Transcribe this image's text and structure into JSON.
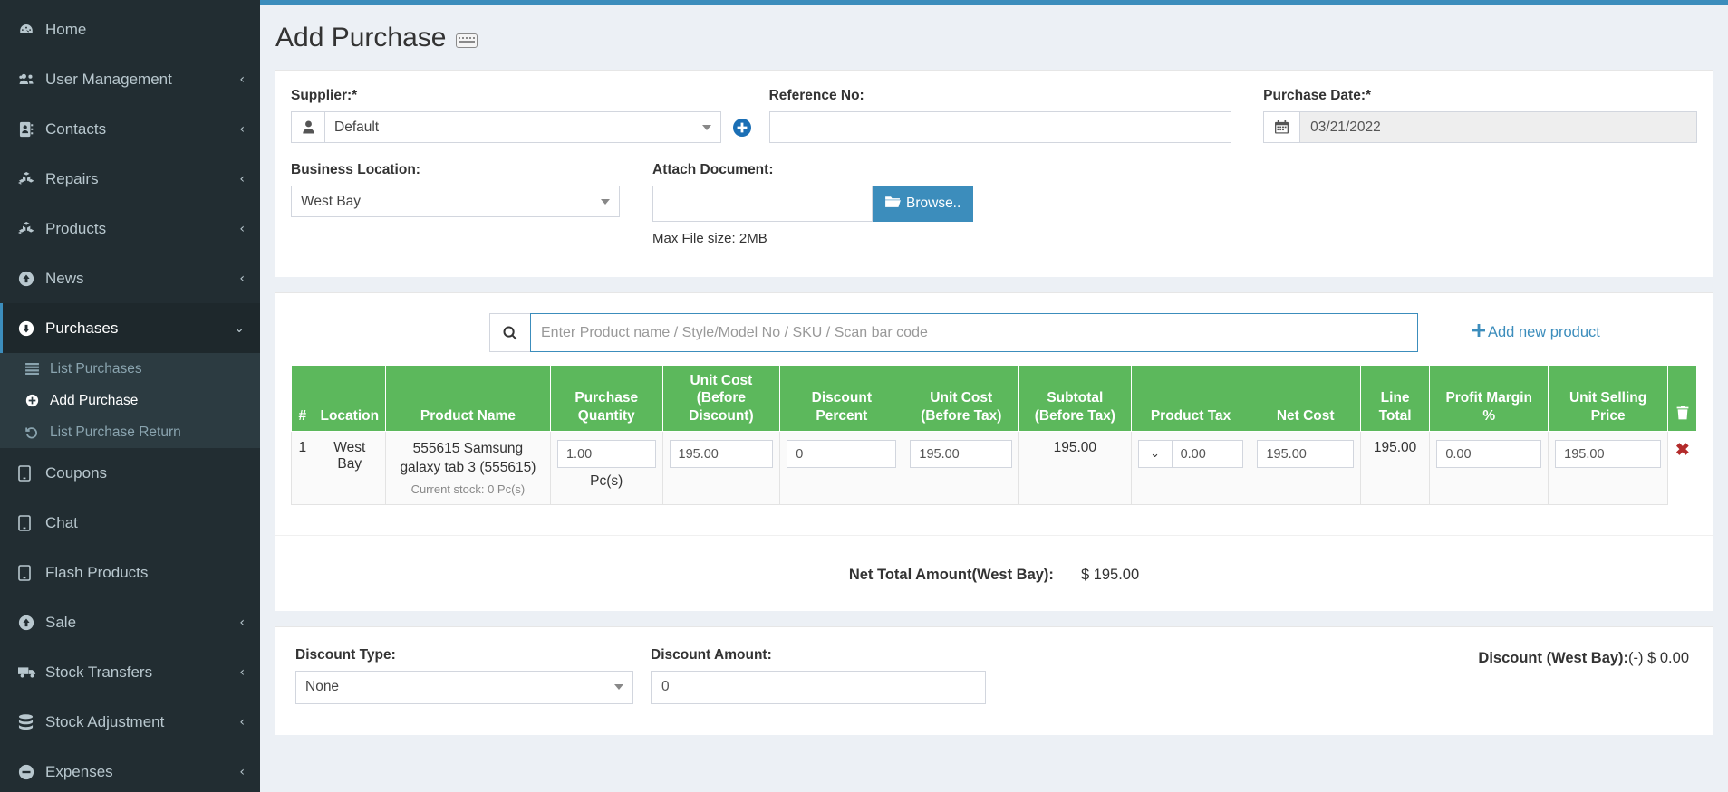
{
  "theme": {
    "accent": "#3c8dbc",
    "sidebar_bg": "#222d32",
    "table_header_green": "#5cb85c",
    "link_blue": "#3c8dbc",
    "delete_red": "#b32b2b"
  },
  "header": {
    "title": "Add Purchase",
    "keyboard_icon": "keyboard-icon"
  },
  "sidebar": {
    "items": [
      {
        "label": "Home",
        "icon": "dashboard-icon",
        "chevron": ""
      },
      {
        "label": "User Management",
        "icon": "users-icon",
        "chevron": "‹"
      },
      {
        "label": "Contacts",
        "icon": "address-book-icon",
        "chevron": "‹"
      },
      {
        "label": "Repairs",
        "icon": "cubes-icon",
        "chevron": "‹"
      },
      {
        "label": "Products",
        "icon": "cubes-icon",
        "chevron": "‹"
      },
      {
        "label": "News",
        "icon": "arrow-up-circle-icon",
        "chevron": "‹"
      },
      {
        "label": "Purchases",
        "icon": "arrow-down-circle-icon",
        "chevron": "⌄",
        "active": true
      }
    ],
    "subitems": [
      {
        "label": "List Purchases",
        "icon": "list-icon",
        "active": false
      },
      {
        "label": "Add Purchase",
        "icon": "plus-circle-icon",
        "active": true
      },
      {
        "label": "List Purchase Return",
        "icon": "undo-icon",
        "active": false
      }
    ],
    "items_after": [
      {
        "label": "Coupons",
        "icon": "tablet-icon",
        "chevron": ""
      },
      {
        "label": "Chat",
        "icon": "tablet-icon",
        "chevron": ""
      },
      {
        "label": "Flash Products",
        "icon": "tablet-icon",
        "chevron": ""
      },
      {
        "label": "Sale",
        "icon": "arrow-up-circle-icon",
        "chevron": "‹"
      },
      {
        "label": "Stock Transfers",
        "icon": "truck-icon",
        "chevron": "‹"
      },
      {
        "label": "Stock Adjustment",
        "icon": "database-icon",
        "chevron": "‹"
      },
      {
        "label": "Expenses",
        "icon": "minus-circle-icon",
        "chevron": "‹"
      }
    ]
  },
  "form": {
    "supplier_label": "Supplier:*",
    "supplier_value": "Default",
    "supplier_icon": "user-icon",
    "add_supplier_icon": "plus-circle-icon",
    "reference_label": "Reference No:",
    "reference_value": "",
    "reference_placeholder": "",
    "purchase_date_label": "Purchase Date:*",
    "purchase_date_value": "03/21/2022",
    "calendar_icon": "calendar-icon",
    "business_location_label": "Business Location:",
    "business_location_value": "West Bay",
    "attach_document_label": "Attach Document:",
    "browse_label": "Browse..",
    "browse_icon": "folder-open-icon",
    "max_file_size": "Max File size: 2MB"
  },
  "product_search": {
    "icon": "search-icon",
    "placeholder": "Enter Product name / Style/Model No / SKU / Scan bar code",
    "value": "",
    "add_new_product": "Add new product",
    "add_icon": "plus-icon"
  },
  "table": {
    "headers": [
      "#",
      "Location",
      "Product Name",
      "Purchase Quantity",
      "Unit Cost (Before Discount)",
      "Discount Percent",
      "Unit Cost (Before Tax)",
      "Subtotal (Before Tax)",
      "Product Tax",
      "Net Cost",
      "Line Total",
      "Profit Margin %",
      "Unit Selling Price"
    ],
    "headers_multiline": [
      [
        "#"
      ],
      [
        "Location"
      ],
      [
        "Product Name"
      ],
      [
        "Purchase",
        "Quantity"
      ],
      [
        "Unit Cost",
        "(Before",
        "Discount)"
      ],
      [
        "Discount",
        "Percent"
      ],
      [
        "Unit Cost",
        "(Before Tax)"
      ],
      [
        "Subtotal",
        "(Before Tax)"
      ],
      [
        "Product Tax"
      ],
      [
        "Net Cost"
      ],
      [
        "Line",
        "Total"
      ],
      [
        "Profit Margin",
        "%"
      ],
      [
        "Unit Selling",
        "Price"
      ]
    ],
    "delete_column_icon": "trash-icon",
    "rows": [
      {
        "index": "1",
        "location": "West Bay",
        "product_name": "555615 Samsung galaxy tab 3 (555615)",
        "current_stock": "Current stock: 0 Pc(s)",
        "purchase_quantity": "1.00",
        "unit_label": "Pc(s)",
        "unit_cost_before_discount": "195.00",
        "discount_percent": "0",
        "unit_cost_before_tax": "195.00",
        "subtotal_before_tax": "195.00",
        "product_tax": "0.00",
        "net_cost": "195.00",
        "line_total": "195.00",
        "profit_margin": "0.00",
        "unit_selling_price": "195.00",
        "remove_icon": "close-x-icon"
      }
    ]
  },
  "totals": {
    "net_total_label": "Net Total Amount(West Bay):",
    "net_total_value": "$ 195.00"
  },
  "discount": {
    "type_label": "Discount Type:",
    "type_value": "None",
    "amount_label": "Discount Amount:",
    "amount_value": "0",
    "summary_label": "Discount (West Bay):",
    "summary_sign": "(-)",
    "summary_value": "$ 0.00"
  }
}
